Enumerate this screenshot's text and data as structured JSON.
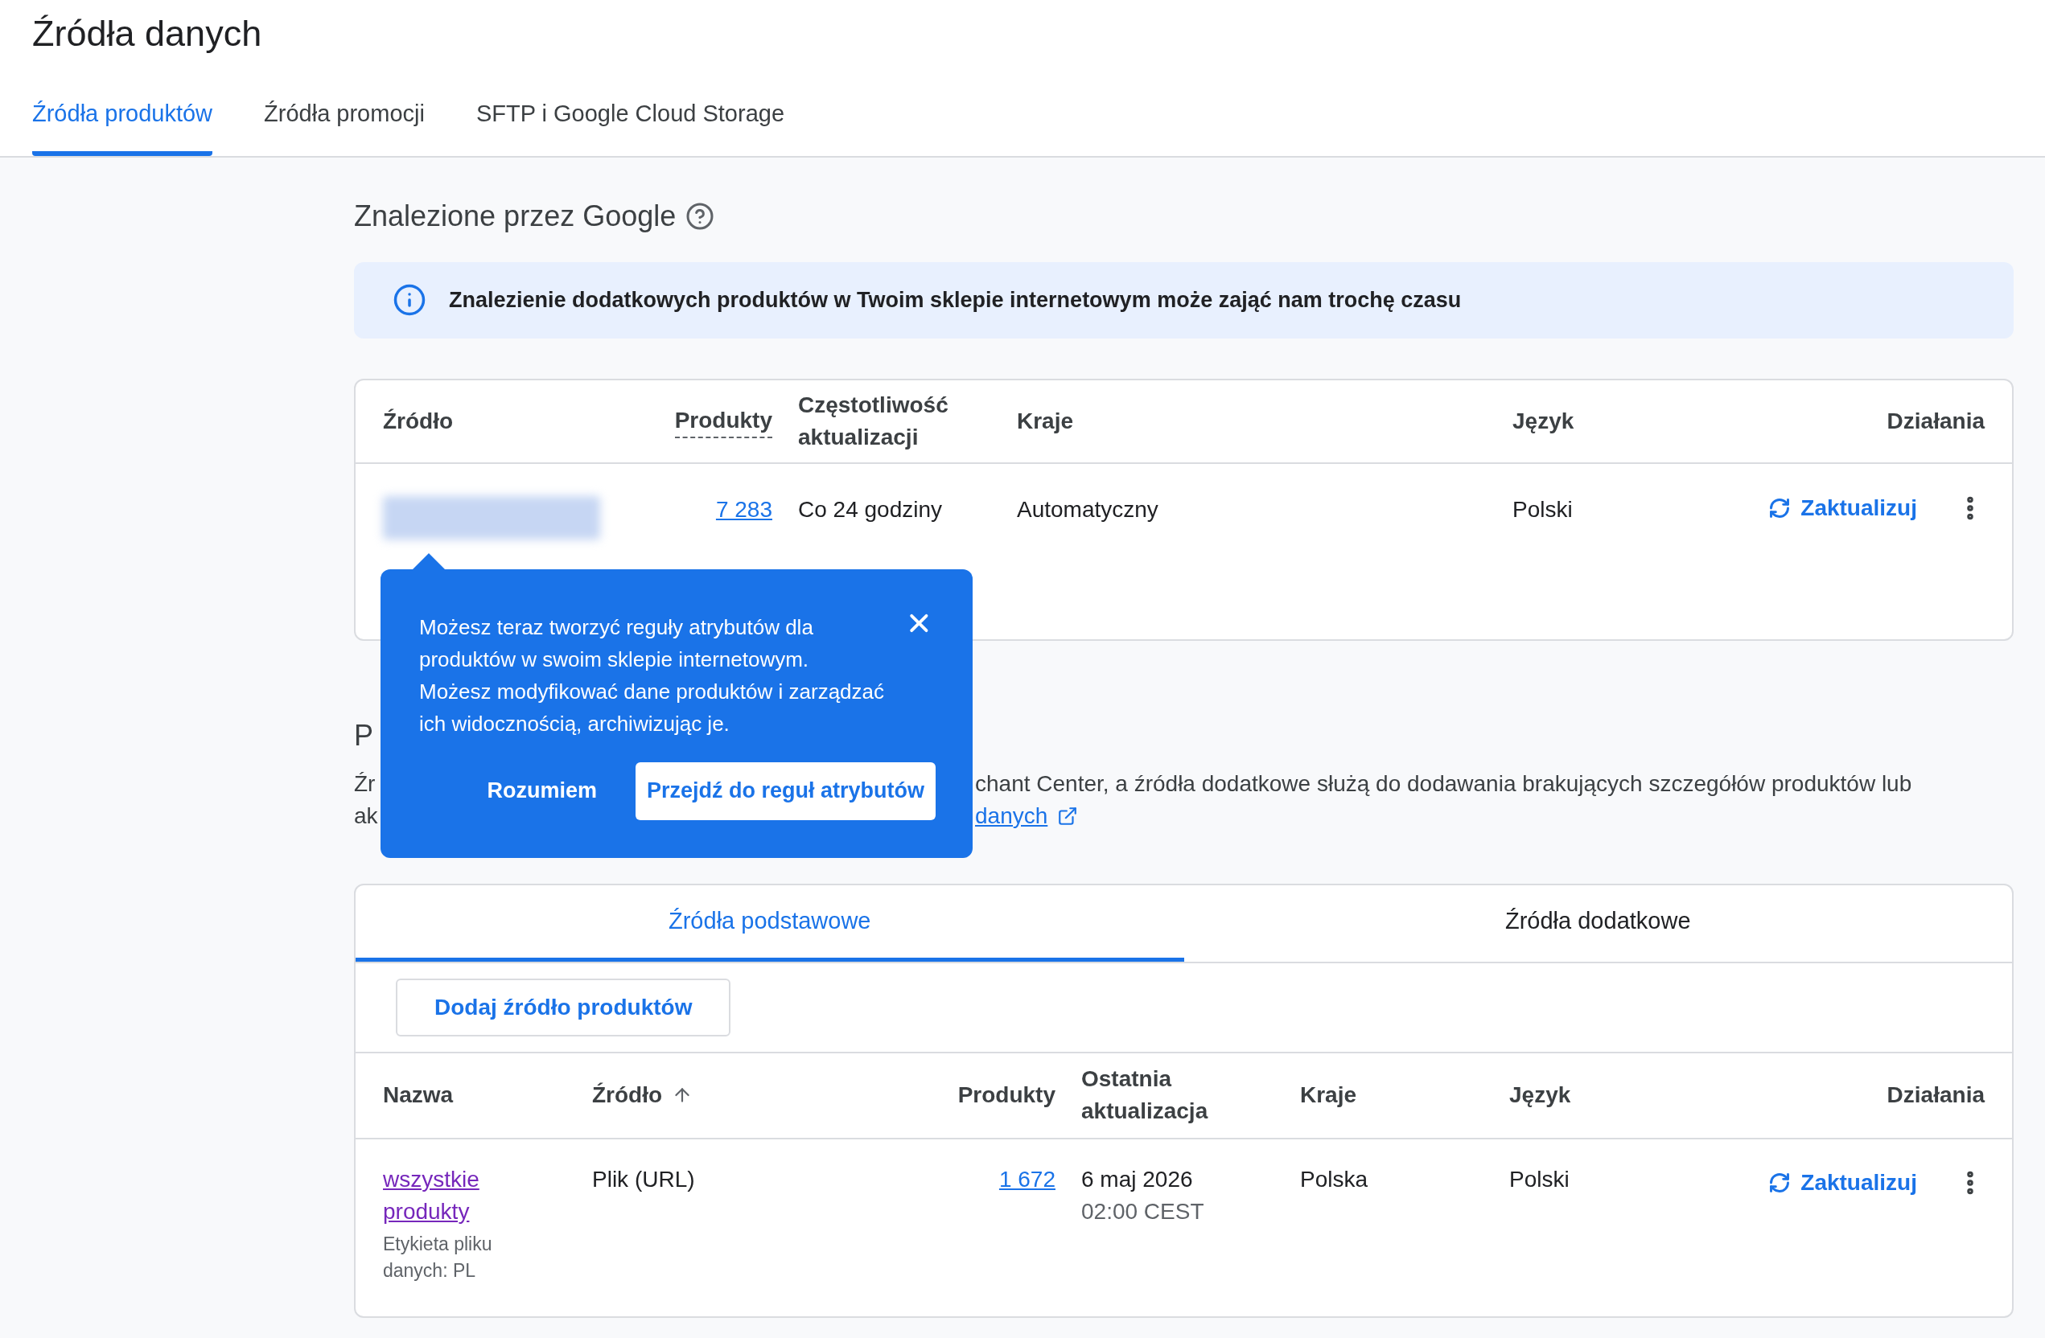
{
  "page": {
    "title": "Źródła danych"
  },
  "tabs": [
    {
      "label": "Źródła produktów",
      "selected": true
    },
    {
      "label": "Źródła promocji",
      "selected": false
    },
    {
      "label": "SFTP i Google Cloud Storage",
      "selected": false
    }
  ],
  "found": {
    "heading": "Znalezione przez Google",
    "banner": "Znalezienie dodatkowych produktów w Twoim sklepie internetowym może zająć nam trochę czasu",
    "columns": [
      {
        "label": "Źródło",
        "hint": false
      },
      {
        "label": "Produkty",
        "hint": true
      },
      {
        "label": "Częstotliwość aktualizacji",
        "hint": false
      },
      {
        "label": "Kraje",
        "hint": false
      },
      {
        "label": "Język",
        "hint": false
      },
      {
        "label": "Działania",
        "hint": false
      }
    ],
    "rows": [
      {
        "products": "7 283",
        "frequency": "Co 24 godziny",
        "countries": "Automatyczny",
        "language": "Polski",
        "action": "Zaktualizuj"
      }
    ]
  },
  "section": {
    "heading_fragment": "P",
    "line1_start": "Źr",
    "line1_end": "chant Center, a źródła dodatkowe służą do dodawania brakujących szczegółów produktów lub",
    "line2_start": "ak",
    "line2_link": "danych"
  },
  "popup": {
    "text": "Możesz teraz tworzyć reguły atrybutów dla produktów w swoim sklepie internetowym. Możesz modyfikować dane produktów i zarządzać ich widocznością, archiwizując je.",
    "dismiss": "Rozumiem",
    "primary": "Przejdź do reguł atrybutów"
  },
  "sub_tabs": [
    {
      "label": "Źródła podstawowe",
      "selected": true
    },
    {
      "label": "Źródła dodatkowe",
      "selected": false
    }
  ],
  "primary": {
    "add_button": "Dodaj źródło produktów",
    "columns": [
      {
        "label": "Nazwa",
        "sorted": false
      },
      {
        "label": "Źródło",
        "sorted": true
      },
      {
        "label": "Produkty",
        "sorted": false
      },
      {
        "label": "Ostatnia aktualizacja",
        "sorted": false
      },
      {
        "label": "Kraje",
        "sorted": false
      },
      {
        "label": "Język",
        "sorted": false
      },
      {
        "label": "Działania",
        "sorted": false
      }
    ],
    "rows": [
      {
        "name": "wszystkie produkty",
        "label": "Etykieta pliku danych: PL",
        "source": "Plik (URL)",
        "products": "1 672",
        "date": "6 maj 2026",
        "time": "02:00 CEST",
        "countries": "Polska",
        "language": "Polski",
        "action": "Zaktualizuj"
      }
    ]
  }
}
